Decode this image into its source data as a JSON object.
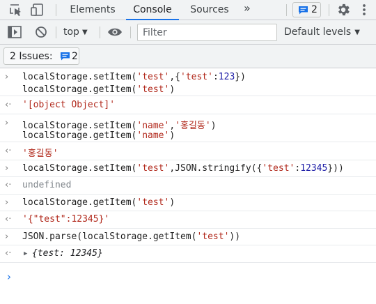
{
  "tabs": {
    "items": [
      {
        "label": "Elements"
      },
      {
        "label": "Console"
      },
      {
        "label": "Sources"
      }
    ],
    "more_glyph": "»",
    "issues_count": "2"
  },
  "toolbar": {
    "context": "top",
    "filter_placeholder": "Filter",
    "levels": "Default levels",
    "dropdown_glyph": "▼"
  },
  "issues_bar": {
    "label": "2 Issues:",
    "count": "2"
  },
  "console": {
    "entries": [
      {
        "input": [
          "localStorage.setItem('test',{'test':123})",
          "localStorage.getItem('test')"
        ],
        "output": "'[object Object]'"
      },
      {
        "input": [
          "localStorage.setItem('name','홍길동')",
          "localStorage.getItem('name')"
        ],
        "output": "'홍길동'"
      },
      {
        "input": [
          "localStorage.setItem('test',JSON.stringify({'test':12345}))"
        ],
        "output": "undefined"
      },
      {
        "input": [
          "localStorage.getItem('test')"
        ],
        "output": "'{\"test\":12345}'"
      },
      {
        "input": [
          "JSON.parse(localStorage.getItem('test'))"
        ],
        "output": "{test: 12345}"
      }
    ]
  },
  "icons": {
    "inspect": "inspect-element-icon",
    "device": "device-toolbar-icon",
    "gear": "gear-icon",
    "kebab": "more-vertical-icon",
    "sidebar": "show-sidebar-icon",
    "clear": "clear-console-icon",
    "eye": "live-expression-icon",
    "issue": "issue-message-icon"
  },
  "colors": {
    "accent": "#1a73e8",
    "string": "#b1281b",
    "number": "#1a1aa6",
    "muted": "#80868b"
  }
}
